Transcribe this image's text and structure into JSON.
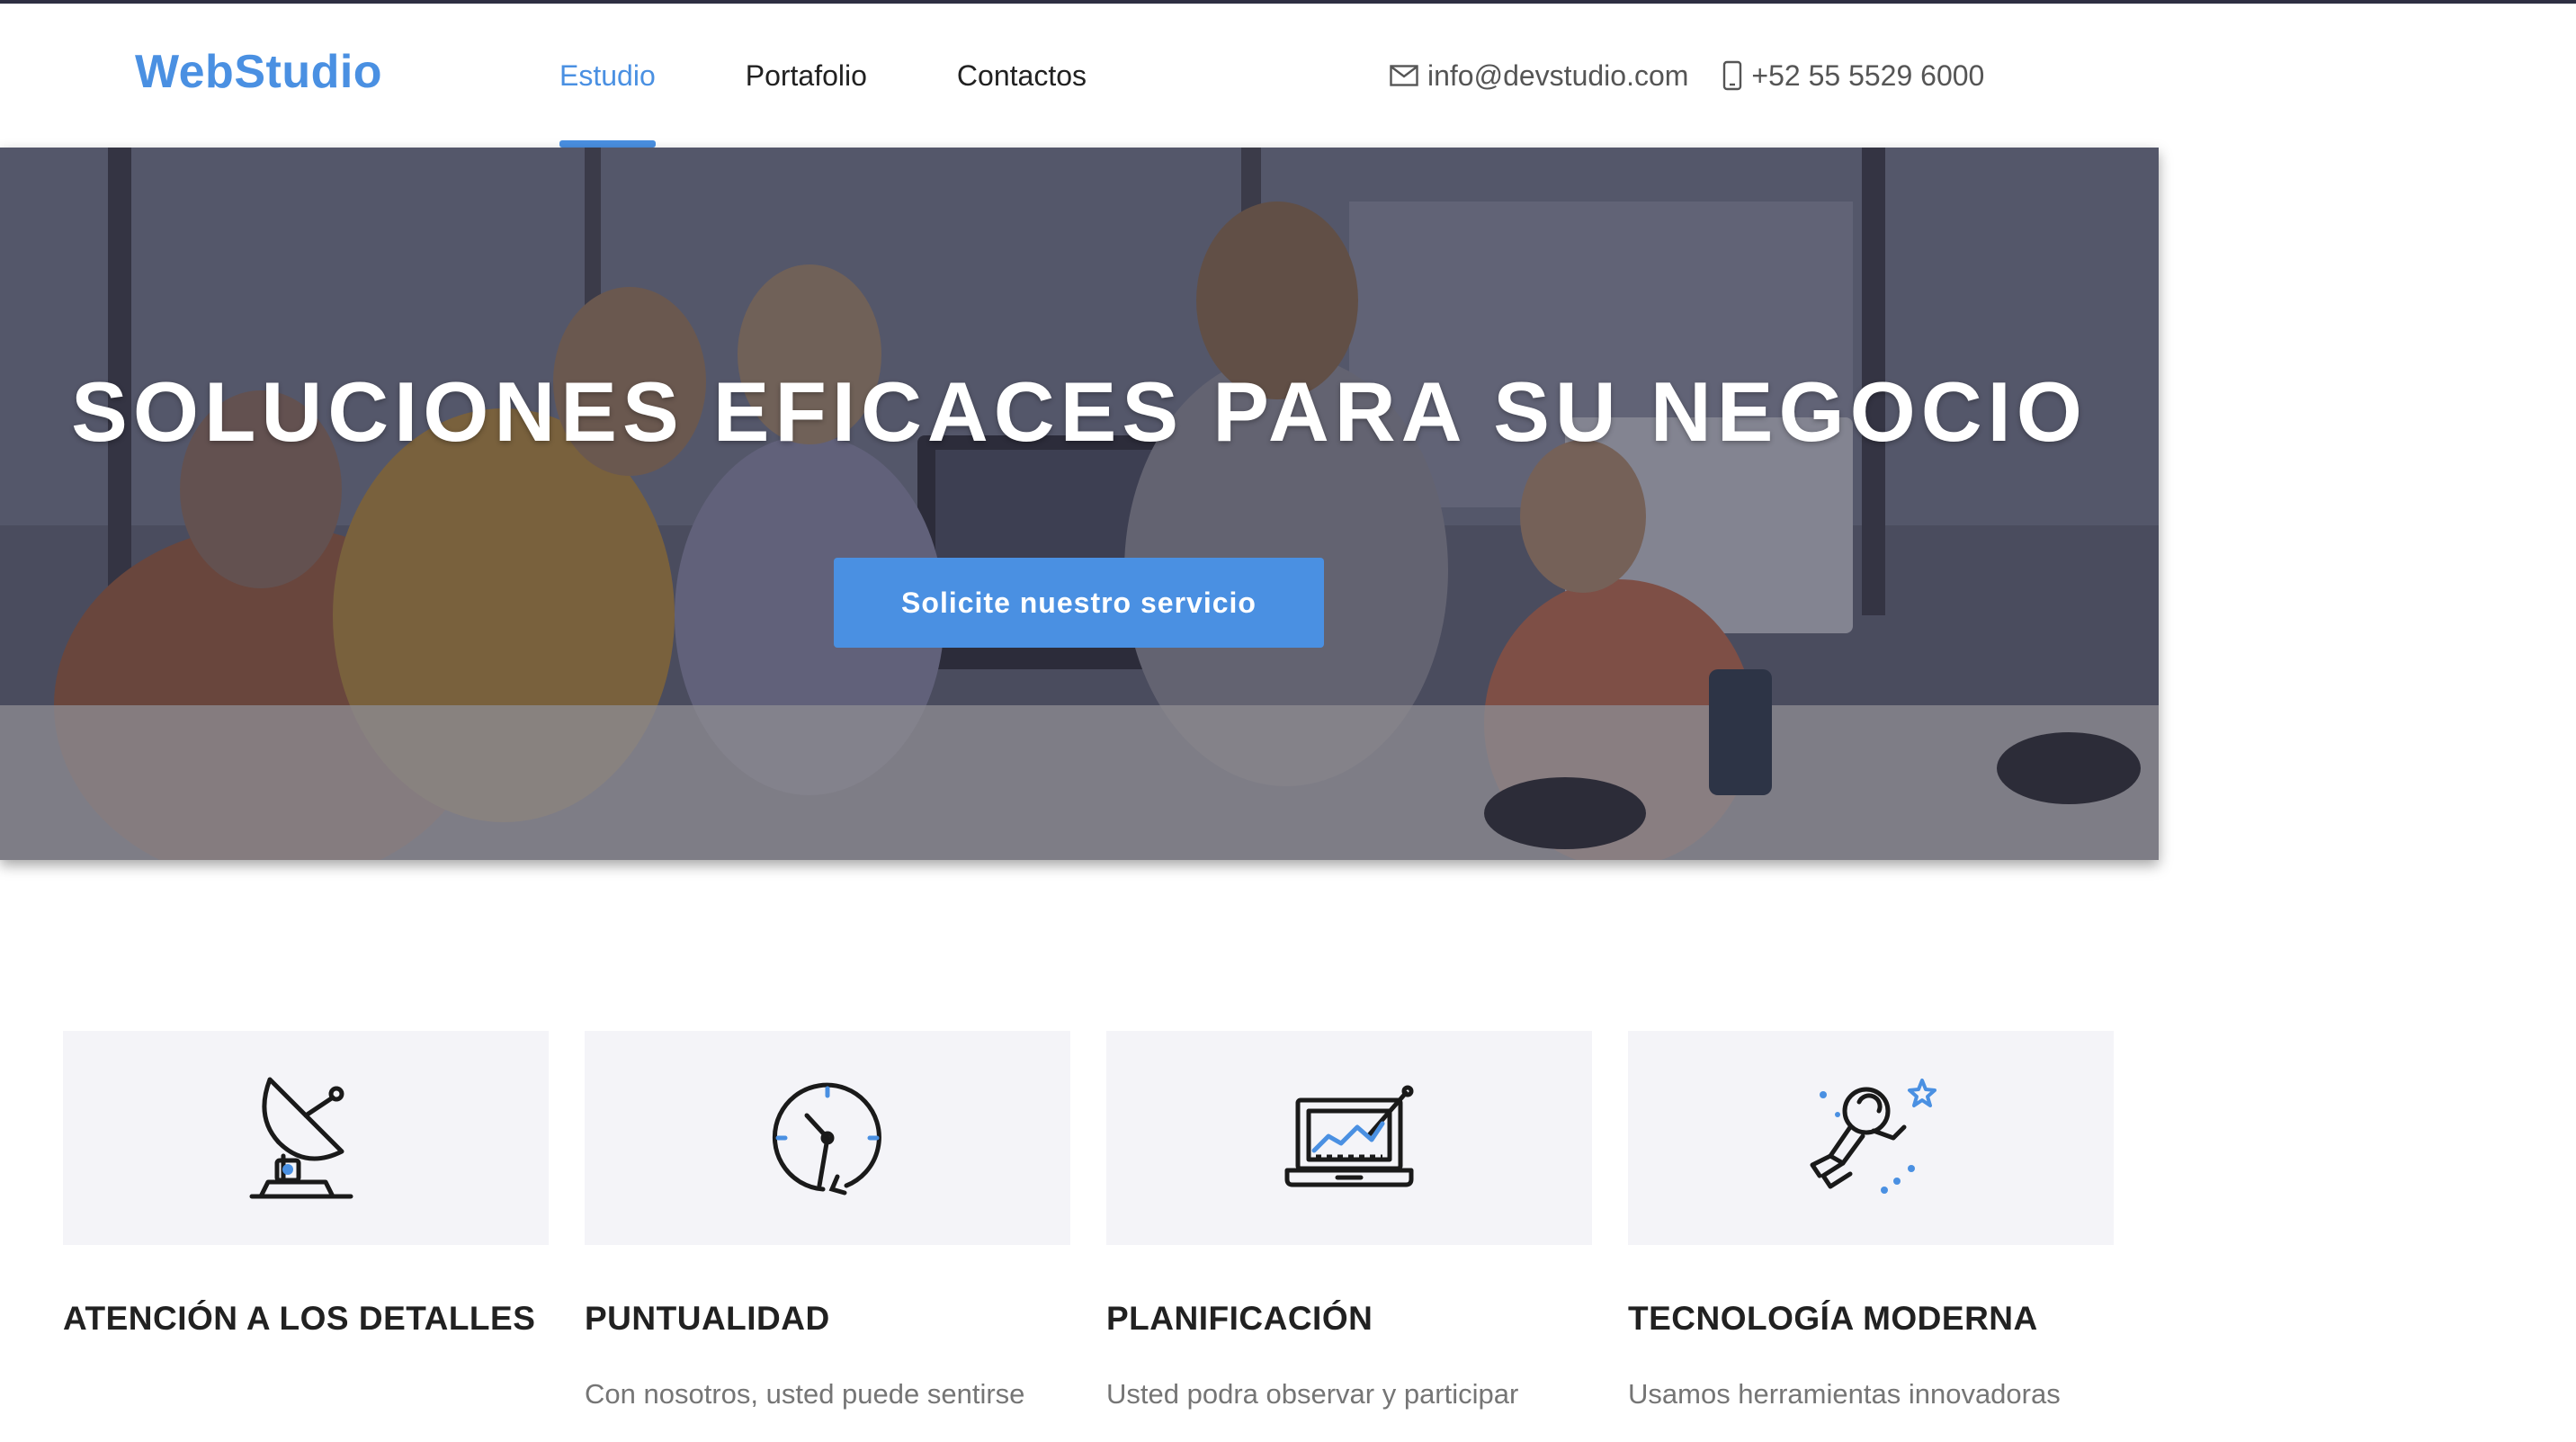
{
  "header": {
    "logo": "WebStudio",
    "nav": [
      {
        "label": "Estudio",
        "active": true
      },
      {
        "label": "Portafolio",
        "active": false
      },
      {
        "label": "Contactos",
        "active": false
      }
    ],
    "email": "info@devstudio.com",
    "phone": "+52 55 5529 6000"
  },
  "hero": {
    "title": "SOLUCIONES EFICACES PARA SU NEGOCIO",
    "button": "Solicite nuestro servicio"
  },
  "features": [
    {
      "icon": "satellite-dish-icon",
      "title": "ATENCIÓN A LOS DETALLES",
      "text": ""
    },
    {
      "icon": "clock-icon",
      "title": "PUNTUALIDAD",
      "text": "Con nosotros, usted puede sentirse"
    },
    {
      "icon": "laptop-chart-icon",
      "title": "PLANIFICACIÓN",
      "text": "Usted podra observar y participar"
    },
    {
      "icon": "astronaut-icon",
      "title": "TECNOLOGÍA MODERNA",
      "text": "Usamos herramientas innovadoras"
    }
  ],
  "colors": {
    "accent": "#4a90e2",
    "dark": "#2e2f42",
    "card_bg": "#f4f4f8"
  }
}
